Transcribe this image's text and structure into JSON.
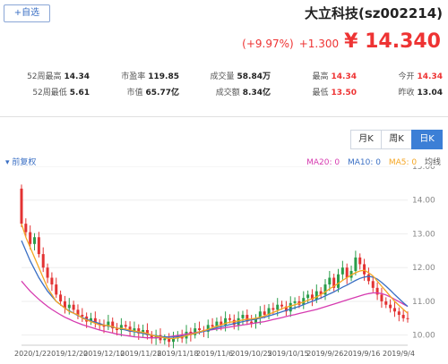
{
  "header": {
    "title": "大立科技(sz002214)",
    "add_button": "+自选"
  },
  "quote": {
    "price": "¥ 14.340",
    "change": "+1.300",
    "change_pct": "(+9.97%)"
  },
  "stats": {
    "open_label": "今开",
    "open": "14.34",
    "prev_close_label": "昨收",
    "prev_close": "13.04",
    "high_label": "最高",
    "high": "14.34",
    "low_label": "最低",
    "low": "13.50",
    "volume_label": "成交量",
    "volume": "58.84万",
    "amount_label": "成交额",
    "amount": "8.34亿",
    "pe_label": "市盈率",
    "pe": "119.85",
    "mcap_label": "市值",
    "mcap": "65.77亿",
    "w52_high_label": "52周最高",
    "w52_high": "14.34",
    "w52_low_label": "52周最低",
    "w52_low": "5.61"
  },
  "tabs": [
    "日K",
    "周K",
    "月K"
  ],
  "active_tab": "日K",
  "adjust_label": "前复权",
  "ma_legend": {
    "label": "均线",
    "ma5": "MA5: 0",
    "ma10": "MA10: 0",
    "ma20": "MA20: 0"
  },
  "colors": {
    "up": "#e33333",
    "down": "#2a9d4a",
    "ma5": "#f5a623",
    "ma10": "#3a6fc4",
    "ma20": "#d63bb0",
    "accent": "#3c7fd6"
  },
  "chart_data": {
    "type": "candlestick",
    "y_ticks": [
      "15.00",
      "14.00",
      "13.00",
      "12.00",
      "11.00",
      "10.00"
    ],
    "x_ticks": [
      "2020/1/2",
      "2019/12/20",
      "2019/12/10",
      "2019/11/28",
      "2019/11/18",
      "2019/11/6",
      "2019/10/25",
      "2019/10/15",
      "2019/9/26",
      "2019/9/16",
      "2019/9/4"
    ],
    "ylim": [
      9.7,
      15.0
    ],
    "closes": [
      14.34,
      13.3,
      13.05,
      12.7,
      12.9,
      12.4,
      12.0,
      11.7,
      11.5,
      11.2,
      11.0,
      10.8,
      10.9,
      10.75,
      10.6,
      10.55,
      10.4,
      10.5,
      10.35,
      10.3,
      10.25,
      10.4,
      10.2,
      10.15,
      10.3,
      10.25,
      10.1,
      10.2,
      10.05,
      10.15,
      10.0,
      9.9,
      10.0,
      9.85,
      9.9,
      9.8,
      9.9,
      10.0,
      9.9,
      10.1,
      10.0,
      10.2,
      10.15,
      10.1,
      10.3,
      10.25,
      10.4,
      10.3,
      10.5,
      10.45,
      10.3,
      10.5,
      10.6,
      10.4,
      10.35,
      10.5,
      10.7,
      10.6,
      10.8,
      10.75,
      10.9,
      10.85,
      10.7,
      10.95,
      11.0,
      10.9,
      11.1,
      11.2,
      11.05,
      11.3,
      11.2,
      11.5,
      11.7,
      11.4,
      11.8,
      12.0,
      11.7,
      11.9,
      12.3,
      12.1,
      11.8,
      11.6,
      11.4,
      11.2,
      11.0,
      10.9,
      10.8,
      10.7,
      10.6,
      10.5
    ],
    "ma5": [
      13.3,
      12.9,
      12.6,
      12.3,
      12.0,
      11.7,
      11.4,
      11.2,
      11.0,
      10.9,
      10.8,
      10.7,
      10.65,
      10.6,
      10.5,
      10.45,
      10.4,
      10.35,
      10.3,
      10.3,
      10.28,
      10.25,
      10.2,
      10.2,
      10.18,
      10.15,
      10.12,
      10.1,
      10.08,
      10.05,
      10.0,
      9.97,
      9.95,
      9.92,
      9.9,
      9.9,
      9.92,
      9.95,
      9.98,
      10.02,
      10.05,
      10.1,
      10.13,
      10.17,
      10.22,
      10.26,
      10.3,
      10.35,
      10.38,
      10.4,
      10.42,
      10.45,
      10.47,
      10.48,
      10.5,
      10.53,
      10.57,
      10.62,
      10.67,
      10.72,
      10.78,
      10.83,
      10.86,
      10.9,
      10.94,
      10.98,
      11.03,
      11.08,
      11.13,
      11.2,
      11.28,
      11.37,
      11.45,
      11.53,
      11.62,
      11.7,
      11.78,
      11.85,
      11.9,
      11.92,
      11.85,
      11.75,
      11.6,
      11.45,
      11.3,
      11.15,
      11.0,
      10.88,
      10.76,
      10.65
    ],
    "ma10": [
      12.8,
      12.5,
      12.2,
      11.95,
      11.7,
      11.5,
      11.3,
      11.15,
      11.0,
      10.9,
      10.8,
      10.72,
      10.65,
      10.58,
      10.52,
      10.47,
      10.42,
      10.38,
      10.34,
      10.3,
      10.27,
      10.24,
      10.21,
      10.18,
      10.15,
      10.12,
      10.1,
      10.08,
      10.05,
      10.02,
      10.0,
      9.98,
      9.96,
      9.95,
      9.94,
      9.94,
      9.95,
      9.97,
      9.99,
      10.02,
      10.05,
      10.08,
      10.11,
      10.14,
      10.18,
      10.22,
      10.25,
      10.28,
      10.31,
      10.34,
      10.37,
      10.4,
      10.43,
      10.45,
      10.47,
      10.5,
      10.53,
      10.57,
      10.61,
      10.65,
      10.69,
      10.73,
      10.77,
      10.81,
      10.85,
      10.9,
      10.95,
      11.0,
      11.05,
      11.1,
      11.16,
      11.22,
      11.28,
      11.35,
      11.42,
      11.48,
      11.55,
      11.62,
      11.68,
      11.72,
      11.74,
      11.72,
      11.66,
      11.56,
      11.45,
      11.33,
      11.2,
      11.08,
      10.96,
      10.85
    ],
    "ma20": [
      11.6,
      11.45,
      11.3,
      11.18,
      11.06,
      10.95,
      10.85,
      10.76,
      10.68,
      10.6,
      10.53,
      10.47,
      10.41,
      10.36,
      10.31,
      10.27,
      10.23,
      10.19,
      10.15,
      10.12,
      10.09,
      10.06,
      10.03,
      10.01,
      9.99,
      9.97,
      9.95,
      9.94,
      9.93,
      9.92,
      9.92,
      9.92,
      9.93,
      9.94,
      9.95,
      9.97,
      9.99,
      10.01,
      10.03,
      10.05,
      10.07,
      10.1,
      10.12,
      10.14,
      10.16,
      10.18,
      10.2,
      10.22,
      10.24,
      10.26,
      10.28,
      10.3,
      10.32,
      10.34,
      10.36,
      10.38,
      10.4,
      10.43,
      10.46,
      10.49,
      10.52,
      10.55,
      10.58,
      10.61,
      10.64,
      10.67,
      10.7,
      10.73,
      10.76,
      10.8,
      10.84,
      10.88,
      10.92,
      10.96,
      11.0,
      11.04,
      11.08,
      11.12,
      11.16,
      11.2,
      11.23,
      11.25,
      11.25,
      11.23,
      11.19,
      11.13,
      11.06,
      10.99,
      10.92,
      10.85
    ]
  }
}
